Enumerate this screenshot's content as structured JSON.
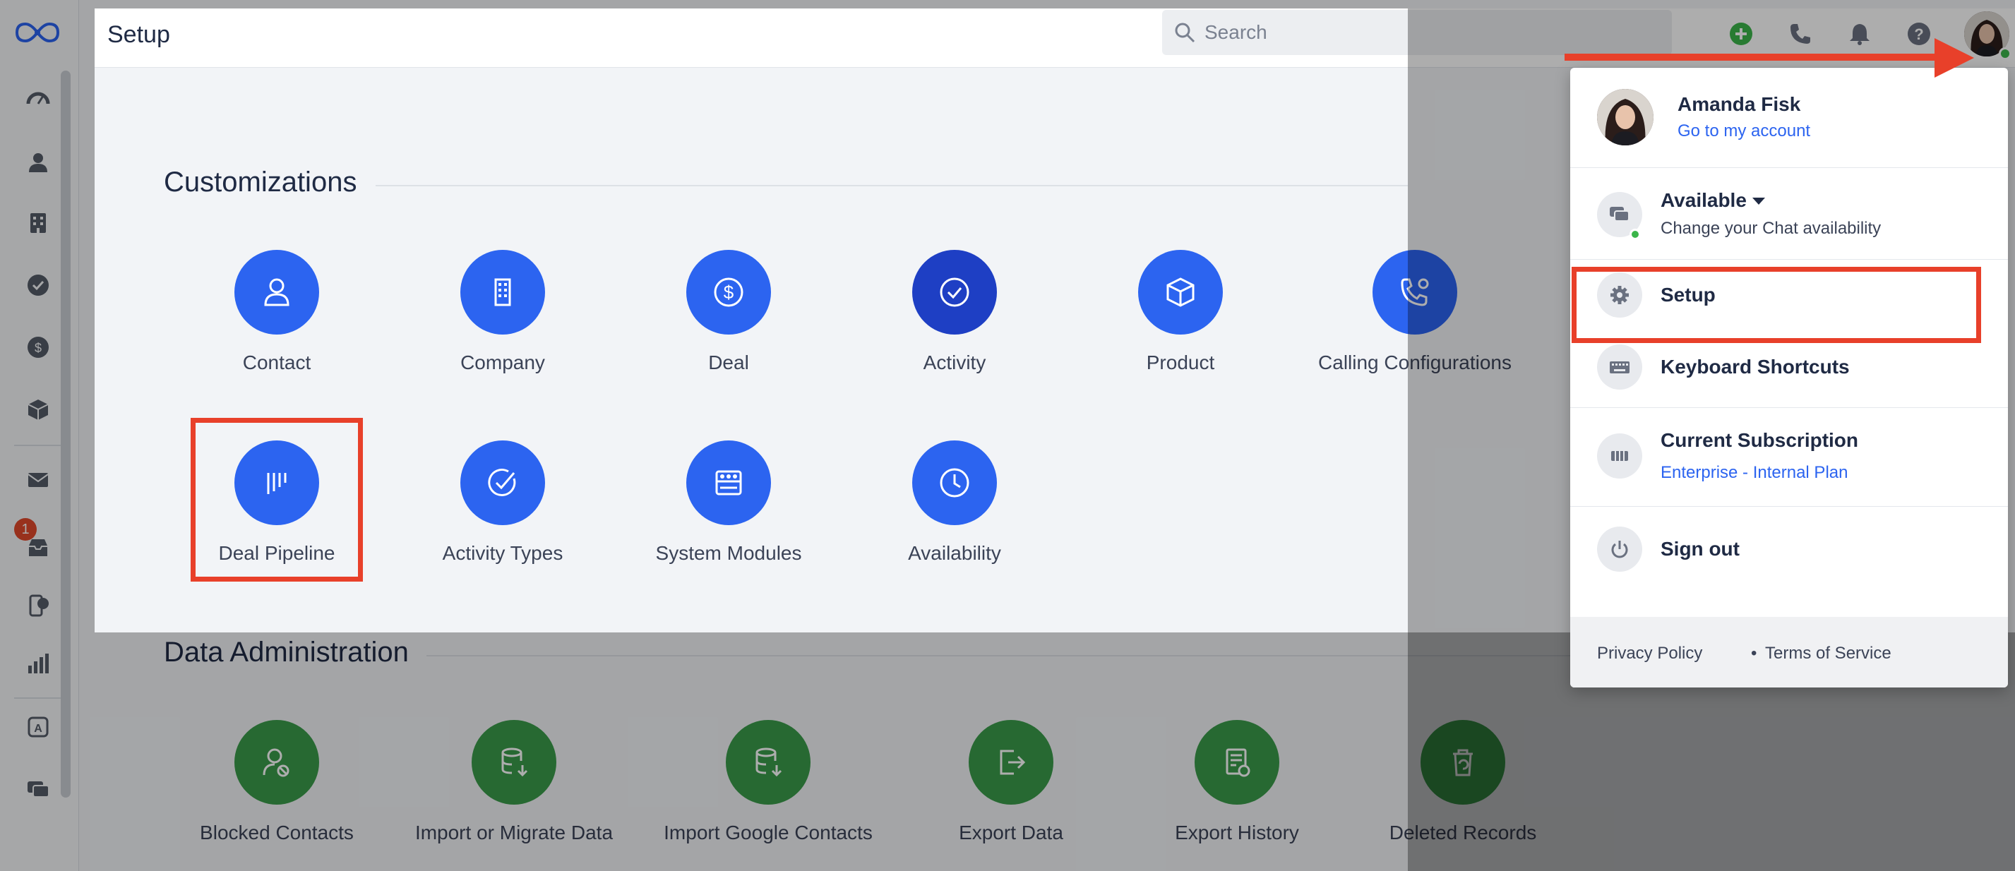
{
  "header": {
    "title": "Setup",
    "search_placeholder": "Search"
  },
  "nav": {
    "items": [
      "logo-icon",
      "dashboard-icon",
      "contacts-icon",
      "companies-icon",
      "tasks-icon",
      "deals-icon",
      "products-icon",
      "email-icon",
      "inbox-icon",
      "phone-chat-icon",
      "reports-icon",
      "automation-icon",
      "chat-icon"
    ],
    "inbox_badge": "1"
  },
  "customizations": {
    "title": "Customizations",
    "tiles": [
      {
        "label": "Contact",
        "icon": "person-icon"
      },
      {
        "label": "Company",
        "icon": "building-icon"
      },
      {
        "label": "Deal",
        "icon": "dollar-icon"
      },
      {
        "label": "Activity",
        "icon": "check-circle-icon"
      },
      {
        "label": "Product",
        "icon": "box-icon"
      },
      {
        "label": "Calling Configurations",
        "icon": "phone-gear-icon"
      },
      {
        "label": "Deal Pipeline",
        "icon": "pipeline-icon"
      },
      {
        "label": "Activity Types",
        "icon": "activity-check-icon"
      },
      {
        "label": "System Modules",
        "icon": "modules-icon"
      },
      {
        "label": "Availability",
        "icon": "clock-icon"
      }
    ]
  },
  "data_admin": {
    "title": "Data Administration",
    "tiles": [
      {
        "label": "Blocked Contacts",
        "icon": "blocked-person-icon"
      },
      {
        "label": "Import or Migrate Data",
        "icon": "database-import-icon"
      },
      {
        "label": "Import Google Contacts",
        "icon": "database-download-icon"
      },
      {
        "label": "Export Data",
        "icon": "export-icon"
      },
      {
        "label": "Export History",
        "icon": "history-doc-icon"
      },
      {
        "label": "Deleted Records",
        "icon": "trash-restore-icon"
      }
    ]
  },
  "account_menu": {
    "user_name": "Amanda Fisk",
    "account_link": "Go to my account",
    "status": "Available",
    "status_sub": "Change your Chat availability",
    "setup": "Setup",
    "shortcuts": "Keyboard Shortcuts",
    "subscription": "Current Subscription",
    "plan": "Enterprise - Internal Plan",
    "sign_out": "Sign out",
    "privacy": "Privacy Policy",
    "separator": "•",
    "terms": "Terms of Service"
  },
  "colors": {
    "tile_blue": "#2c64f0",
    "tile_navy": "#1e3fc4",
    "tile_green": "#3a9b4b",
    "annotation_red": "#e8402a",
    "status_green": "#3bb54a"
  }
}
